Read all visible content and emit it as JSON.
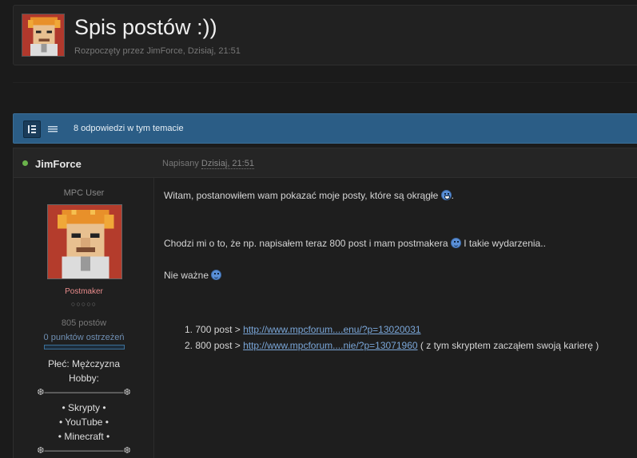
{
  "topic": {
    "title": "Spis postów :))",
    "meta": "Rozpoczęty przez JimForce, Dzisiaj, 21:51"
  },
  "bar": {
    "text": "8 odpowiedzi w tym temacie"
  },
  "post": {
    "author": "JimForce",
    "posted_prefix": "Napisany",
    "posted_date": "Dzisiaj, 21:51",
    "user_title": "MPC User",
    "group": "Postmaker",
    "pips": "○○○○○",
    "posts_count": "805 postów",
    "warnings": "0 punktów ostrzeżeń",
    "sex": "Płeć: Mężczyzna",
    "hobby_label": "Hobby:",
    "ornament": "❆―――――――――❆",
    "hobbies": [
      "• Skrypty •",
      "• YouTube •",
      "• Minecraft •"
    ],
    "body": {
      "line1": "Witam, postanowiłem wam pokazać moje posty, które są okrągłe",
      "line2": "Chodzi mi o to, że np. napisałem teraz 800 post i mam postmakera",
      "line2_tail": "I takie wydarzenia..",
      "line3": "Nie ważne"
    },
    "links": [
      {
        "num": "1.",
        "prefix": "700 post >",
        "url": "http://www.mpcforum....enu/?p=13020031",
        "suffix": ""
      },
      {
        "num": "2.",
        "prefix": "800 post >",
        "url": "http://www.mpcforum....nie/?p=13071960",
        "suffix": "( z tym skryptem zacząłem swoją karierę )"
      }
    ]
  },
  "icons": {
    "online": "online-dot-icon",
    "mode_full": "list-full-icon",
    "mode_compact": "list-compact-icon",
    "smiley": "smiley-icon"
  },
  "colors": {
    "accent": "#2b5d86",
    "link": "#7aa6d8",
    "group": "#e98b8b",
    "online": "#6ab34b"
  }
}
